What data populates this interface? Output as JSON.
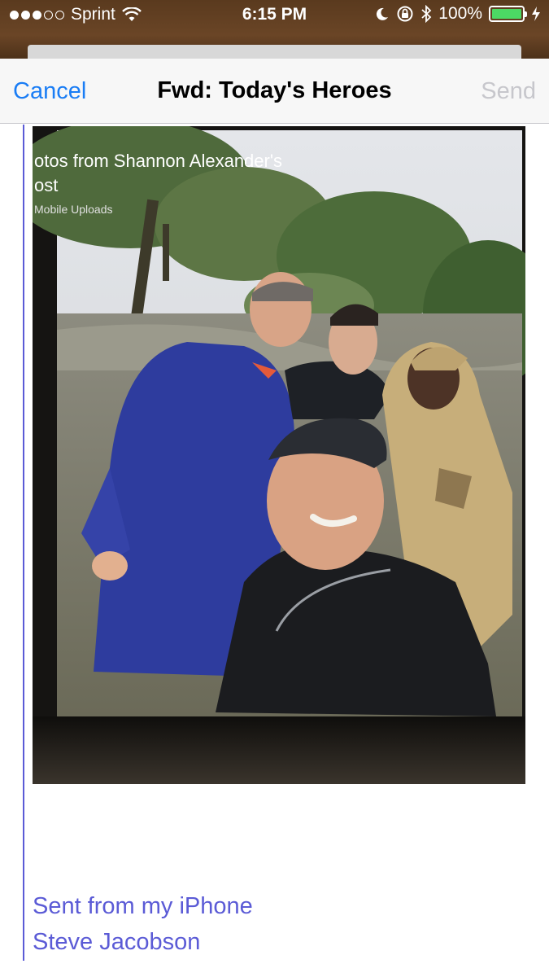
{
  "status_bar": {
    "carrier": "Sprint",
    "time": "6:15 PM",
    "battery": "100%",
    "signal_bars_filled": 3,
    "signal_bars_total": 5
  },
  "nav": {
    "cancel": "Cancel",
    "title": "Fwd: Today's Heroes",
    "send": "Send"
  },
  "photo": {
    "caption_line1": "otos from Shannon Alexander's",
    "caption_line2": "ost",
    "caption_line3": "Mobile Uploads"
  },
  "signature": {
    "line1": "Sent from my iPhone",
    "line2": "Steve Jacobson"
  },
  "colors": {
    "accent": "#1a7df5",
    "quote": "#5b5bd6",
    "battery": "#4cd964"
  }
}
